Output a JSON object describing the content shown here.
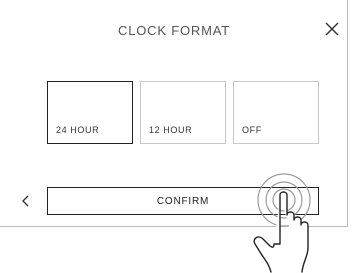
{
  "dialog": {
    "title": "CLOCK FORMAT",
    "close_icon": "close-icon",
    "back_icon": "chevron-left-icon"
  },
  "options": [
    {
      "label": "24 HOUR",
      "selected": true
    },
    {
      "label": "12 HOUR",
      "selected": false
    },
    {
      "label": "OFF",
      "selected": false
    }
  ],
  "actions": {
    "confirm_label": "CONFIRM"
  },
  "hint": {
    "icon": "tap-hand-icon"
  }
}
